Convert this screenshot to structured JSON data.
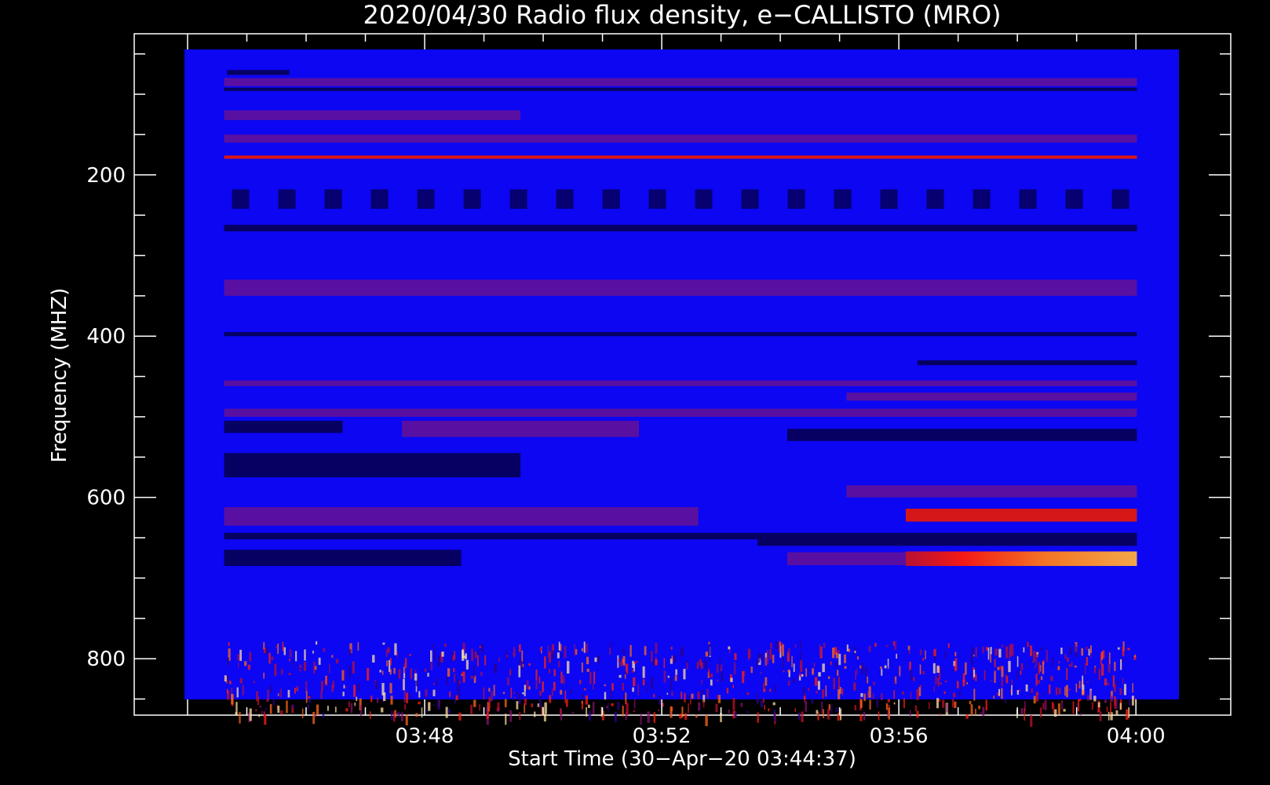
{
  "chart_data": {
    "type": "heatmap",
    "title": "2020/04/30  Radio flux density, e−CALLISTO (MRO)",
    "xlabel": "Start Time (30−Apr−20 03:44:37)",
    "ylabel": "Frequency (MHZ)",
    "x_ticks": [
      "03:48",
      "03:52",
      "03:56",
      "04:00"
    ],
    "y_ticks": [
      "200",
      "400",
      "600",
      "800"
    ],
    "xlim_minutes_after_0344": [
      -0.9,
      17.6
    ],
    "data_extent": {
      "x_start": "03:44:37",
      "x_end": "04:00:00",
      "y_range_mhz": [
        45,
        870
      ]
    },
    "ylim": [
      870,
      25
    ],
    "y_inverted": true,
    "colormap": "red-temperature (black → blue → red → yellow → white)",
    "background_color": "#0c06f2",
    "bands": [
      {
        "f1": 70,
        "f2": 76,
        "t1": 0.05,
        "t2": 1.1,
        "level": "low"
      },
      {
        "f1": 80,
        "f2": 90,
        "t1": 0,
        "t2": 15.4,
        "level": "mid"
      },
      {
        "f1": 92,
        "f2": 96,
        "t1": 0,
        "t2": 15.4,
        "level": "low"
      },
      {
        "f1": 120,
        "f2": 132,
        "t1": 0,
        "t2": 5.0,
        "level": "mid"
      },
      {
        "f1": 150,
        "f2": 160,
        "t1": 0,
        "t2": 15.4,
        "level": "mid"
      },
      {
        "f1": 176,
        "f2": 180,
        "t1": 0,
        "t2": 15.4,
        "level": "high"
      },
      {
        "f1": 218,
        "f2": 242,
        "t1": 0,
        "t2": 15.4,
        "level": "stripes"
      },
      {
        "f1": 262,
        "f2": 270,
        "t1": 0,
        "t2": 15.4,
        "level": "low"
      },
      {
        "f1": 330,
        "f2": 350,
        "t1": 0,
        "t2": 15.4,
        "level": "mid"
      },
      {
        "f1": 395,
        "f2": 400,
        "t1": 0,
        "t2": 15.4,
        "level": "low"
      },
      {
        "f1": 430,
        "f2": 436,
        "t1": 11.7,
        "t2": 15.4,
        "level": "low"
      },
      {
        "f1": 455,
        "f2": 462,
        "t1": 0,
        "t2": 15.4,
        "level": "mid"
      },
      {
        "f1": 470,
        "f2": 480,
        "t1": 10.5,
        "t2": 15.4,
        "level": "mid"
      },
      {
        "f1": 490,
        "f2": 500,
        "t1": 0,
        "t2": 15.4,
        "level": "mid"
      },
      {
        "f1": 505,
        "f2": 520,
        "t1": 0,
        "t2": 2.0,
        "level": "low"
      },
      {
        "f1": 505,
        "f2": 525,
        "t1": 3.0,
        "t2": 7.0,
        "level": "mid"
      },
      {
        "f1": 515,
        "f2": 530,
        "t1": 9.5,
        "t2": 15.4,
        "level": "low"
      },
      {
        "f1": 545,
        "f2": 575,
        "t1": 0,
        "t2": 5.0,
        "level": "low"
      },
      {
        "f1": 585,
        "f2": 600,
        "t1": 10.5,
        "t2": 15.4,
        "level": "mid"
      },
      {
        "f1": 612,
        "f2": 635,
        "t1": 0,
        "t2": 8.0,
        "level": "mid"
      },
      {
        "f1": 614,
        "f2": 630,
        "t1": 11.5,
        "t2": 15.4,
        "level": "high"
      },
      {
        "f1": 644,
        "f2": 652,
        "t1": 0,
        "t2": 15.4,
        "level": "low"
      },
      {
        "f1": 652,
        "f2": 660,
        "t1": 9.0,
        "t2": 15.4,
        "level": "low"
      },
      {
        "f1": 665,
        "f2": 685,
        "t1": 0,
        "t2": 4.0,
        "level": "low"
      },
      {
        "f1": 668,
        "f2": 684,
        "t1": 9.5,
        "t2": 11.5,
        "level": "mid"
      },
      {
        "f1": 667,
        "f2": 685,
        "t1": 11.5,
        "t2": 15.4,
        "level": "hot"
      },
      {
        "f1": 778,
        "f2": 870,
        "t1": 0,
        "t2": 15.4,
        "level": "noise"
      }
    ]
  }
}
